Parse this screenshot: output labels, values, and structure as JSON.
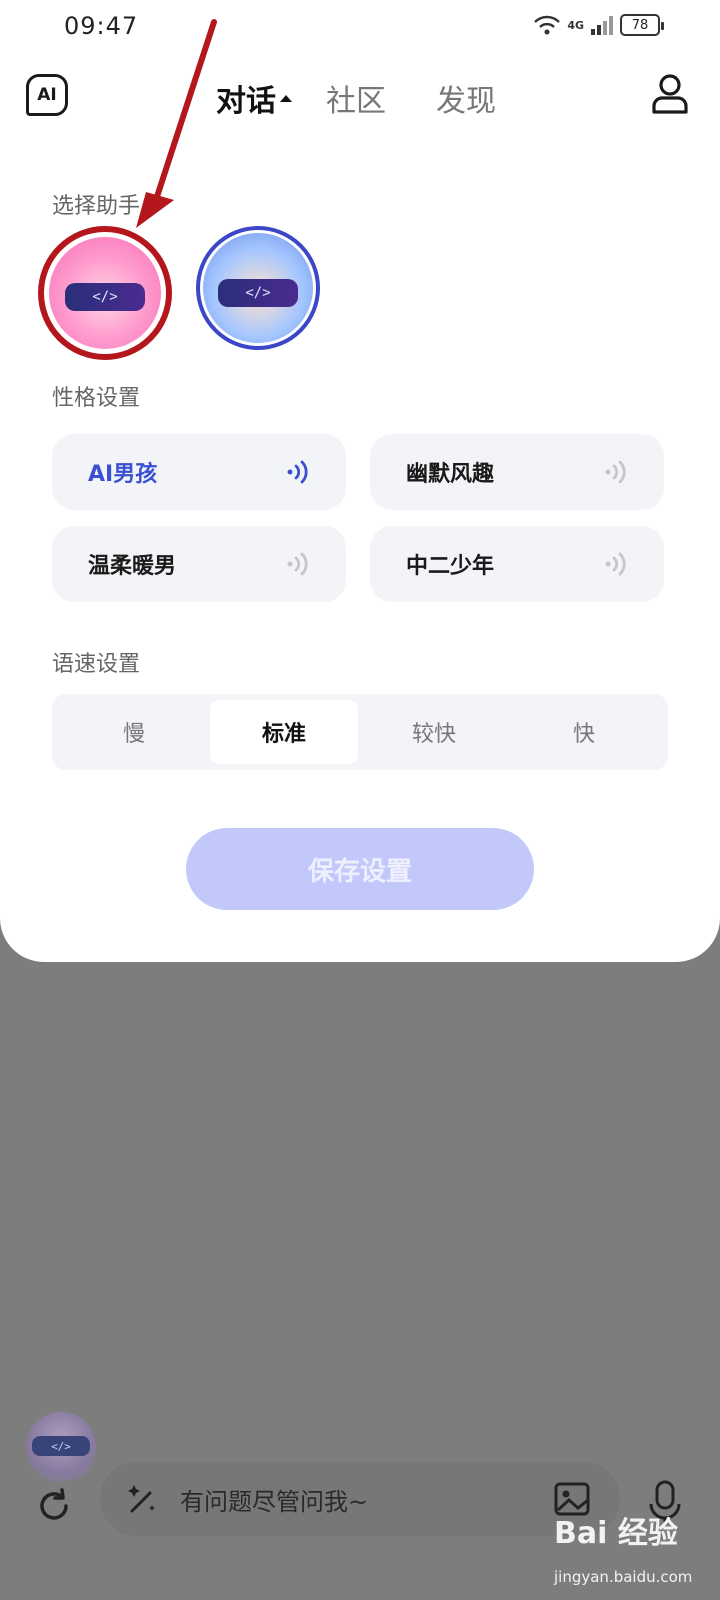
{
  "status_bar": {
    "time": "09:47",
    "network": "4G",
    "battery": "78"
  },
  "nav": {
    "logo": "AI",
    "tabs": [
      {
        "label": "对话",
        "active": true
      },
      {
        "label": "社区",
        "active": false
      },
      {
        "label": "发现",
        "active": false
      }
    ]
  },
  "assistant": {
    "section_label": "选择助手",
    "avatars": [
      {
        "name": "pink-assistant",
        "selected": true
      },
      {
        "name": "blue-assistant",
        "selected": false
      }
    ],
    "visor_text": "</>"
  },
  "personality": {
    "section_label": "性格设置",
    "options": [
      {
        "label": "AI男孩",
        "selected": true
      },
      {
        "label": "幽默风趣",
        "selected": false
      },
      {
        "label": "温柔暖男",
        "selected": false
      },
      {
        "label": "中二少年",
        "selected": false
      }
    ]
  },
  "speed": {
    "section_label": "语速设置",
    "options": [
      {
        "label": "慢",
        "selected": false
      },
      {
        "label": "标准",
        "selected": true
      },
      {
        "label": "较快",
        "selected": false
      },
      {
        "label": "快",
        "selected": false
      }
    ]
  },
  "save_button": "保存设置",
  "chat": {
    "placeholder": "有问题尽管问我~"
  },
  "watermark": {
    "text": "Bai 经验",
    "sub": "jingyan.baidu.com"
  },
  "colors": {
    "accent": "#3b4fd3",
    "annotation": "#b3171b",
    "save_disabled": "#c3c8fa"
  }
}
